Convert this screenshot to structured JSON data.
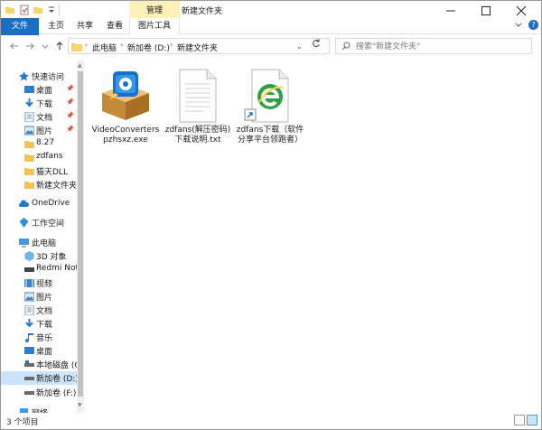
{
  "window": {
    "title": "新建文件夹"
  },
  "ribbon": {
    "tabs": {
      "file": "文件",
      "home": "主页",
      "share": "共享",
      "view": "查看",
      "picture_tools": "图片工具"
    },
    "manage_group": "管理"
  },
  "address": {
    "crumbs": [
      "此电脑",
      "新加卷 (D:)",
      "新建文件夹"
    ]
  },
  "search": {
    "placeholder": "搜索\"新建文件夹\""
  },
  "nav": {
    "quick_access": "快速访问",
    "quick_items": [
      "桌面",
      "下载",
      "文档",
      "图片",
      "8.27",
      "zdfans",
      "猫天DLL",
      "新建文件夹"
    ],
    "onedrive": "OneDrive",
    "workspace": "工作空间",
    "this_pc": "此电脑",
    "pc_items": [
      "3D 对象",
      "Redmi Note",
      "视频",
      "图片",
      "文档",
      "下载",
      "音乐",
      "桌面",
      "本地磁盘 (C:)",
      "新加卷 (D:)",
      "新加卷 (F:)",
      "网络"
    ]
  },
  "files": [
    {
      "name": "VideoConverterspzhsxz.exe",
      "icon": "installer-box-icon"
    },
    {
      "name": "zdfans(解压密码)下载说明.txt",
      "icon": "text-file-icon"
    },
    {
      "name": "zdfans下载（软件分享平台领跑者）",
      "icon": "ie-shortcut-icon"
    }
  ],
  "status": {
    "count": "3 个项目"
  },
  "colors": {
    "accent": "#1a6fc4",
    "selection": "#cce4f7",
    "manage_bg": "#fdf1b8"
  }
}
